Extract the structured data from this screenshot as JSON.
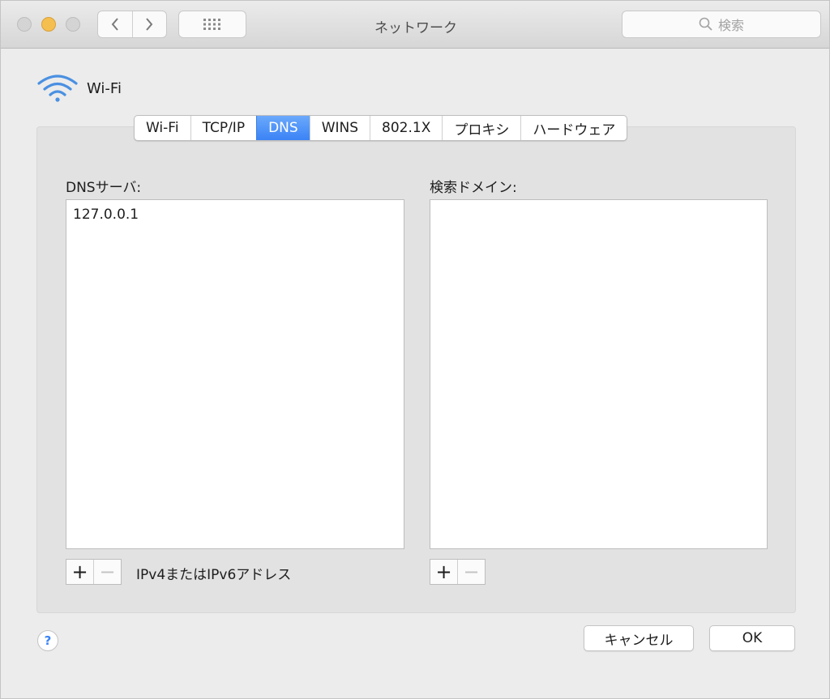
{
  "window": {
    "title": "ネットワーク",
    "search_placeholder": "検索"
  },
  "header": {
    "service_name": "Wi-Fi"
  },
  "tabs": [
    {
      "label": "Wi-Fi",
      "active": false
    },
    {
      "label": "TCP/IP",
      "active": false
    },
    {
      "label": "DNS",
      "active": true
    },
    {
      "label": "WINS",
      "active": false
    },
    {
      "label": "802.1X",
      "active": false
    },
    {
      "label": "プロキシ",
      "active": false
    },
    {
      "label": "ハードウェア",
      "active": false
    }
  ],
  "dns": {
    "servers_label": "DNSサーバ:",
    "servers": [
      "127.0.0.1"
    ],
    "add_label": "+",
    "remove_label": "−",
    "hint": "IPv4またはIPv6アドレス"
  },
  "search_domains": {
    "label": "検索ドメイン:",
    "add_label": "+",
    "remove_label": "−"
  },
  "footer": {
    "help_label": "?",
    "cancel_label": "キャンセル",
    "ok_label": "OK"
  },
  "colors": {
    "accent": "#3b83f6",
    "minimize": "#f5bf4f"
  }
}
